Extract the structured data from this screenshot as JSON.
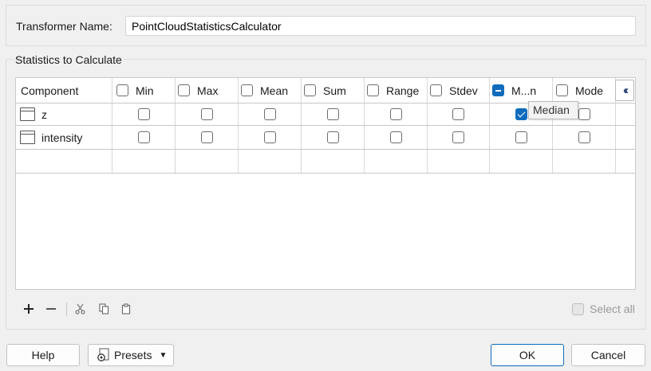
{
  "transformer": {
    "label": "Transformer Name:",
    "value": "PointCloudStatisticsCalculator"
  },
  "stats_group": {
    "label": "Statistics to Calculate",
    "columns": [
      {
        "label": "Component"
      },
      {
        "label": "Min",
        "checked": false
      },
      {
        "label": "Max",
        "checked": false
      },
      {
        "label": "Mean",
        "checked": false
      },
      {
        "label": "Sum",
        "checked": false
      },
      {
        "label": "Range",
        "checked": false
      },
      {
        "label": "Stdev",
        "checked": false
      },
      {
        "label": "M...n",
        "state": "indeterminate"
      },
      {
        "label": "Mode",
        "checked": false
      }
    ],
    "rows": [
      {
        "name": "z",
        "checks": [
          false,
          false,
          false,
          false,
          false,
          false,
          true,
          false
        ]
      },
      {
        "name": "intensity",
        "checks": [
          false,
          false,
          false,
          false,
          false,
          false,
          false,
          false
        ]
      }
    ],
    "collapse_icon": "double-chevron-left-icon",
    "tooltip": "Median",
    "toolbar": {
      "add_icon": "plus-icon",
      "remove_icon": "minus-icon",
      "cut_icon": "scissors-icon",
      "copy_icon": "copy-icon",
      "paste_icon": "clipboard-icon",
      "select_all_label": "Select all"
    }
  },
  "footer": {
    "help_label": "Help",
    "presets_label": "Presets",
    "presets_icon": "gear-document-icon",
    "ok_label": "OK",
    "cancel_label": "Cancel"
  },
  "colors": {
    "accent": "#0f6cbd",
    "background": "#f0f0f0"
  }
}
